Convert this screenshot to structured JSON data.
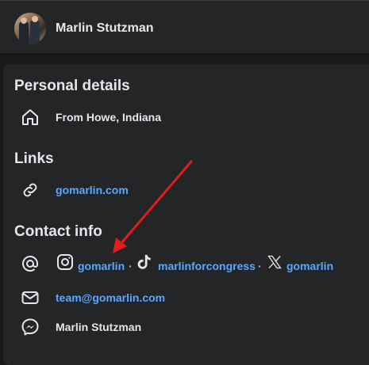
{
  "profile": {
    "name": "Marlin Stutzman"
  },
  "sections": {
    "personal": {
      "title": "Personal details",
      "from": "From Howe, Indiana"
    },
    "links": {
      "title": "Links",
      "website": "gomarlin.com"
    },
    "contact": {
      "title": "Contact info",
      "instagram": "gomarlin",
      "tiktok": "marlinforcongress",
      "x": "gomarlin",
      "separator": "·",
      "email": "team@gomarlin.com",
      "messenger": "Marlin Stutzman"
    }
  },
  "colors": {
    "link": "#5aa7ff",
    "annotation_arrow": "#e11d1d",
    "card": "#242526",
    "background": "#18191a"
  },
  "icons": [
    "house-icon",
    "link-icon",
    "at-icon",
    "instagram-icon",
    "tiktok-icon",
    "x-icon",
    "email-icon",
    "messenger-icon"
  ]
}
